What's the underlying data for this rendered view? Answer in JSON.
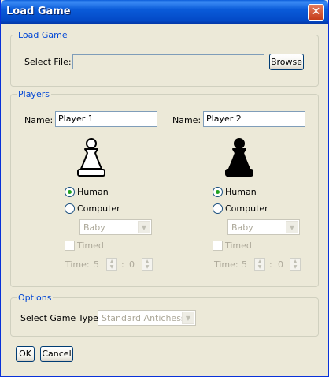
{
  "window": {
    "title": "Load Game",
    "close_glyph": "✕"
  },
  "load_game": {
    "legend": "Load Game",
    "select_file_label": "Select File:",
    "file_value": "",
    "browse_label": "Browse"
  },
  "players": {
    "legend": "Players",
    "left": {
      "name_label": "Name:",
      "name_value": "Player 1",
      "piece_icon": "white-pawn-icon",
      "piece_color": "#FFFFFF",
      "human_label": "Human",
      "computer_label": "Computer",
      "selected": "human",
      "difficulty": "Baby",
      "timed_label": "Timed",
      "timed": false,
      "time_label": "Time:",
      "minutes": "5",
      "separator": ":",
      "seconds": "0"
    },
    "right": {
      "name_label": "Name:",
      "name_value": "Player 2",
      "piece_icon": "black-pawn-icon",
      "piece_color": "#000000",
      "human_label": "Human",
      "computer_label": "Computer",
      "selected": "human",
      "difficulty": "Baby",
      "timed_label": "Timed",
      "timed": false,
      "time_label": "Time:",
      "minutes": "5",
      "separator": ":",
      "seconds": "0"
    }
  },
  "options": {
    "legend": "Options",
    "game_type_label": "Select Game Type:",
    "game_type_value": "Standard Antichess"
  },
  "buttons": {
    "ok_label": "OK",
    "cancel_label": "Cancel"
  }
}
